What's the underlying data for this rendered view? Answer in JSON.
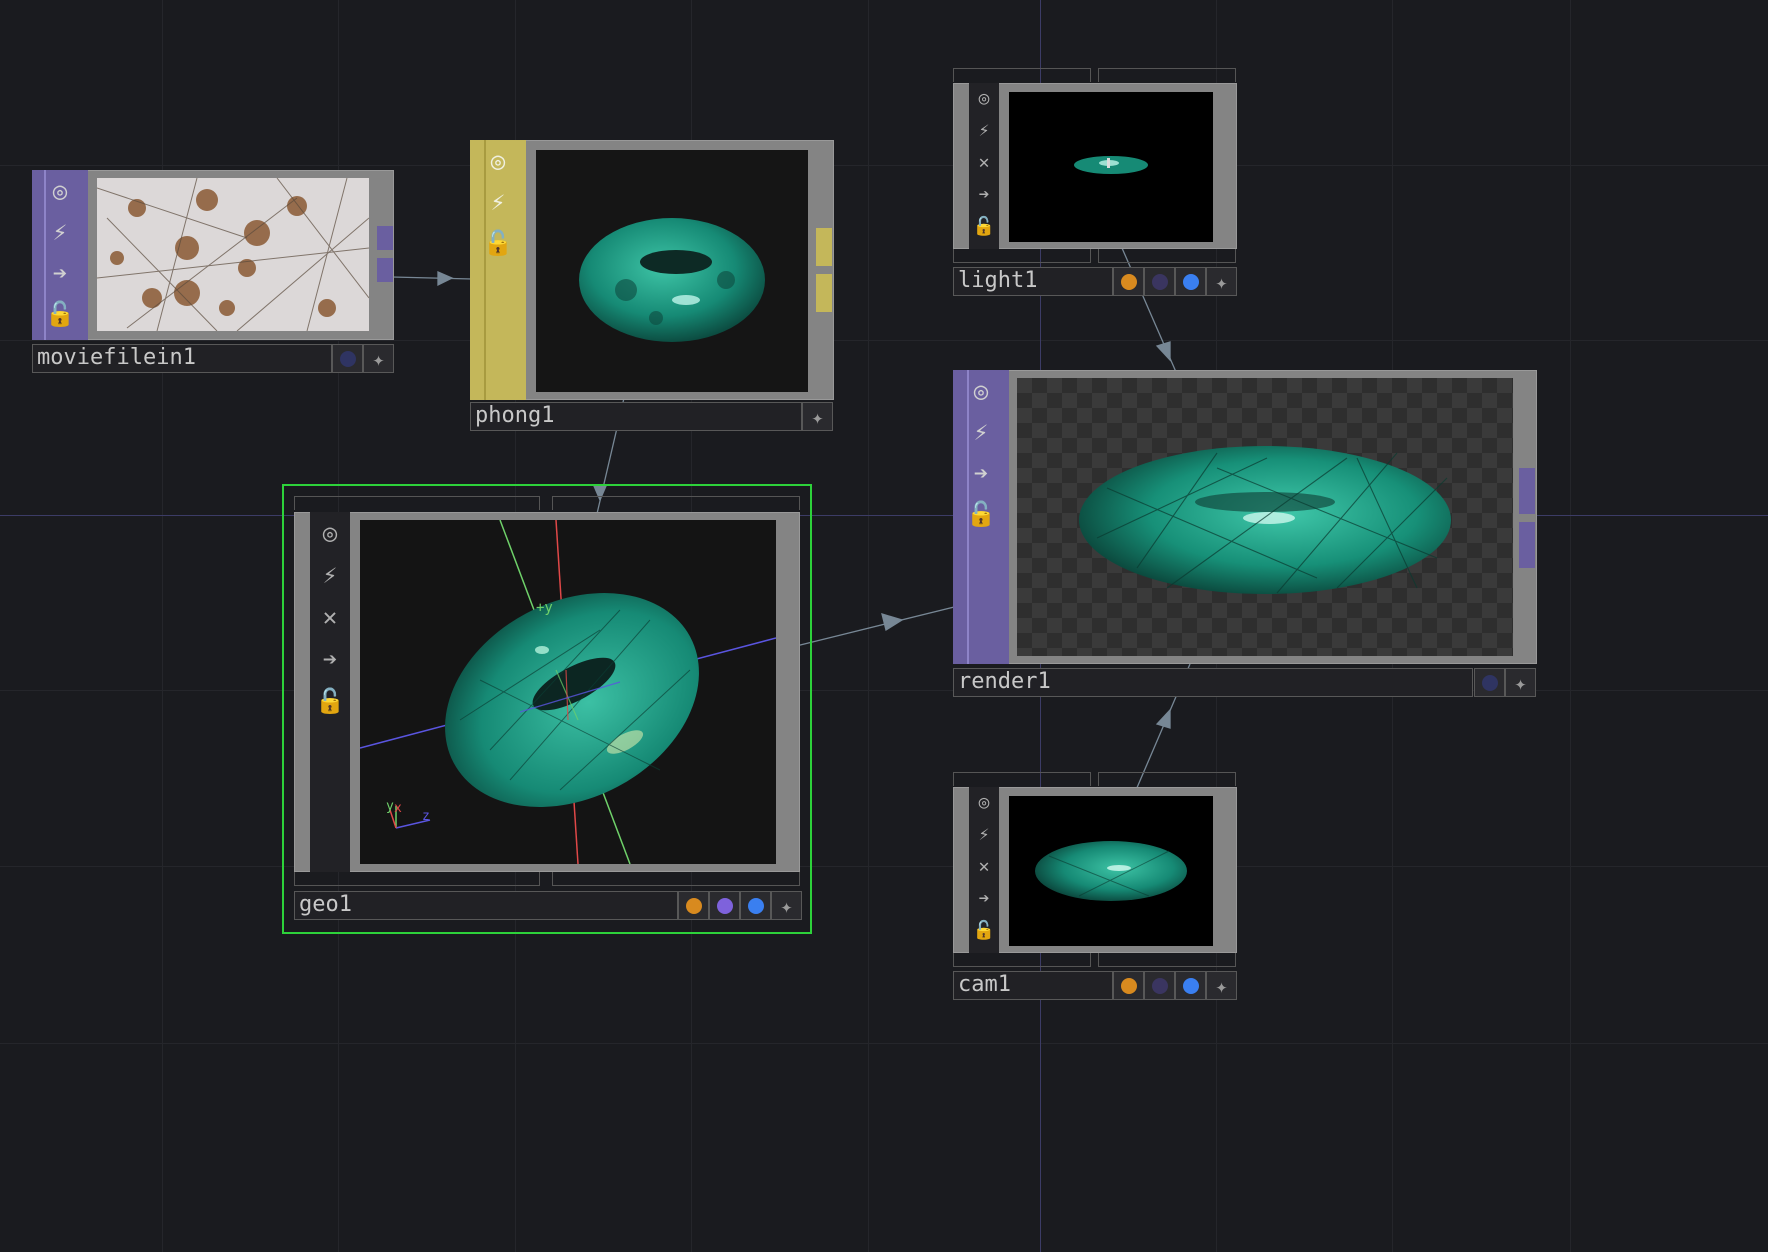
{
  "colors": {
    "background": "#1a1b1f",
    "top_family": "#6a5fa0",
    "mat_family": "#c4b75a",
    "sop_family": "#808080",
    "selection": "#2dd23a",
    "wire": "#8fa3b3",
    "flag_orange": "#d88a1f",
    "flag_purple": "#7e62dc",
    "flag_blue": "#3a7ff0",
    "flag_dim": "#3a3560"
  },
  "icons": [
    "target-icon",
    "viewer-active-icon",
    "bypass-icon",
    "display-icon",
    "lock-icon"
  ],
  "nodes": {
    "moviefilein1": {
      "name": "moviefilein1",
      "family": "TOP",
      "content": "texture image"
    },
    "phong1": {
      "name": "phong1",
      "family": "MAT",
      "content": "torus material preview"
    },
    "geo1": {
      "name": "geo1",
      "family": "COMP",
      "selected": true,
      "axis_label": "+y",
      "gizmo": {
        "x": "x",
        "y": "y",
        "z": "z"
      }
    },
    "light1": {
      "name": "light1",
      "family": "COMP",
      "content": "light viewport"
    },
    "render1": {
      "name": "render1",
      "family": "TOP",
      "content": "rendered torus"
    },
    "cam1": {
      "name": "cam1",
      "family": "COMP",
      "content": "camera viewport"
    }
  }
}
